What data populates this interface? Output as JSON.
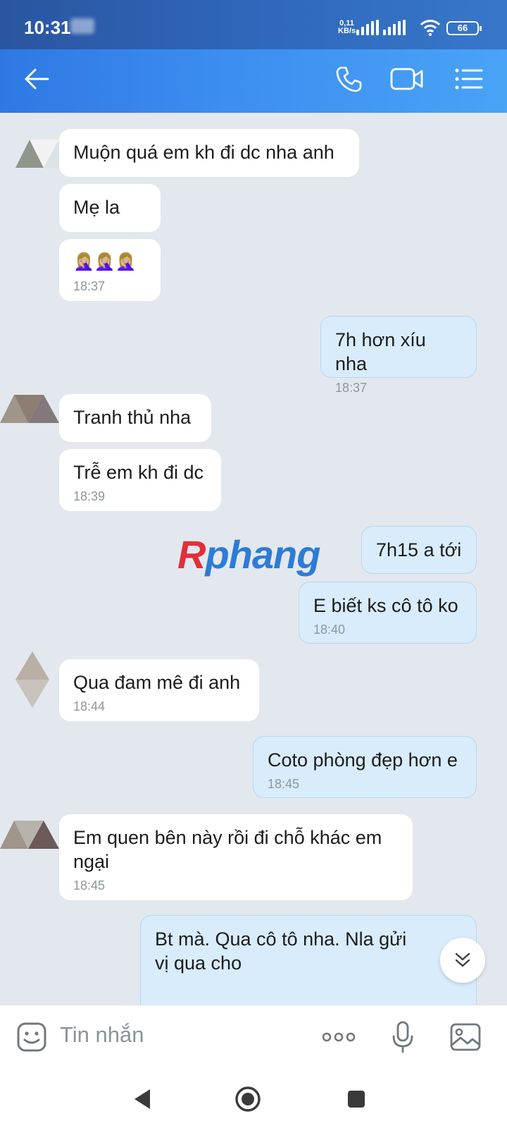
{
  "status": {
    "time": "10:31",
    "net_speed_value": "0,11",
    "net_speed_unit": "KB/s",
    "battery": "66"
  },
  "header": {
    "back_icon": "arrow-left-icon",
    "call_icon": "phone-icon",
    "video_icon": "video-camera-icon",
    "menu_icon": "list-menu-icon"
  },
  "messages": [
    {
      "dir": "in",
      "text": "Muộn quá em kh đi dc nha anh",
      "time": ""
    },
    {
      "dir": "in",
      "text": "Mẹ la",
      "time": ""
    },
    {
      "dir": "in",
      "text": "🤦🏼‍♀️🤦🏼‍♀️🤦🏼‍♀️",
      "time": "18:37"
    },
    {
      "dir": "out",
      "text": "7h hơn xíu nha",
      "time": "18:37"
    },
    {
      "dir": "in",
      "text": "Tranh thủ nha",
      "time": ""
    },
    {
      "dir": "in",
      "text": "Trễ em kh đi dc",
      "time": "18:39"
    },
    {
      "dir": "out",
      "text": "7h15 a tới",
      "time": ""
    },
    {
      "dir": "out",
      "text": "E biết ks cô tô ko",
      "time": "18:40"
    },
    {
      "dir": "in",
      "text": "Qua đam mê đi anh",
      "time": "18:44"
    },
    {
      "dir": "out",
      "text": "Coto phòng đẹp hơn e",
      "time": "18:45"
    },
    {
      "dir": "in",
      "text": "Em quen bên này rồi đi chỗ khác em ngại",
      "time": "18:45"
    },
    {
      "dir": "out",
      "text": "Bt mà. Qua cô tô nha. Nla gửi vị qua cho",
      "time": ""
    }
  ],
  "watermark": {
    "first": "R",
    "rest": "phang"
  },
  "input": {
    "placeholder": "Tin nhắn",
    "sticker_icon": "emoji-sticker-icon",
    "more_icon": "more-dots-icon",
    "mic_icon": "microphone-icon",
    "image_icon": "image-gallery-icon"
  },
  "nav": {
    "back_icon": "nav-back-icon",
    "home_icon": "nav-home-icon",
    "recents_icon": "nav-recents-icon"
  },
  "colors": {
    "header_start": "#2f78e4",
    "header_end": "#49a3f6",
    "chat_bg": "#e3e8ee",
    "bubble_out": "#d8ecfb",
    "bubble_in": "#ffffff"
  }
}
